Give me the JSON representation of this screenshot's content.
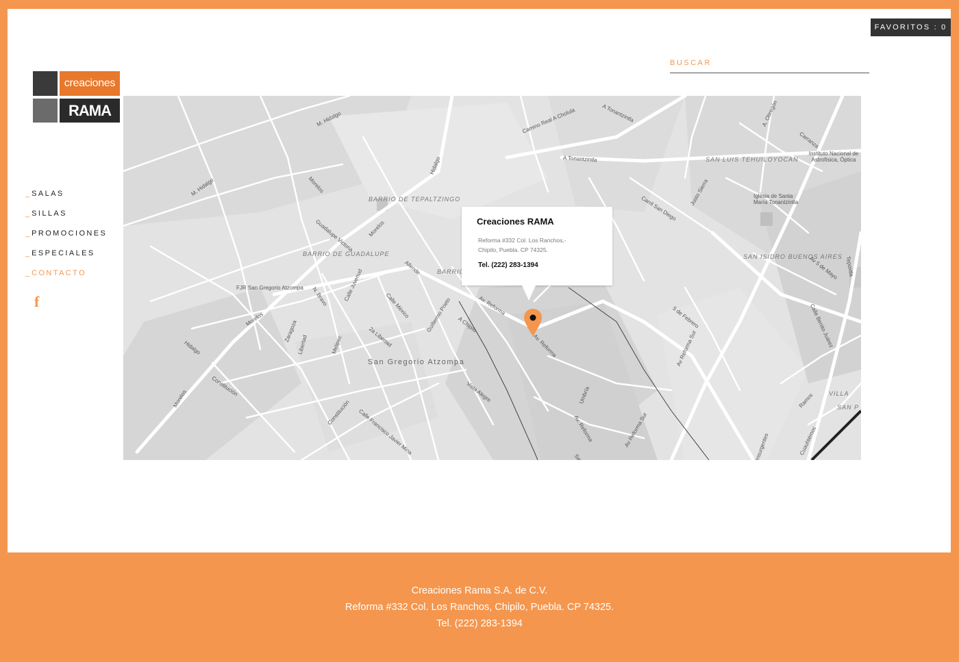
{
  "header": {
    "favorites_label": "FAVORITOS : 0",
    "search_label": "BUSCAR"
  },
  "logo": {
    "top_text": "creaciones",
    "bottom_text": "RAMA"
  },
  "nav": {
    "items": [
      {
        "label": "SALAS",
        "dash": "_"
      },
      {
        "label": "SILLAS",
        "dash": "_"
      },
      {
        "label": "PROMOCIONES",
        "dash": "_"
      },
      {
        "label": "ESPECIALES",
        "dash": "_"
      },
      {
        "label": "CONTACTO",
        "dash": "_"
      }
    ],
    "social_icon": "facebook-icon",
    "social_glyph": "f"
  },
  "map": {
    "labels": {
      "m_hidalgo": "M. Hidalgo",
      "m_hidalgo2": "M. Hidalgo",
      "hidalgo": "Hidalgo",
      "hidalgo2": "Hidalgo",
      "morelos": "Morelos",
      "morelos2": "Morelos",
      "morelos3": "Morelos",
      "morelos4": "Morelos",
      "camino_real": "Camino Real A Cholula",
      "a_tonantzintla": "A Tonantzintla",
      "a_tonantzintla2": "A Tonantzintla",
      "barrio_tepaltzingo": "BARRIO DE TEPALTZINGO",
      "guadalupe_victoria": "Guadalupe Victoria",
      "barrio_guadalupe": "BARRIO DE GUADALUPE",
      "barrio_tzocu": "BARRIO TZOCU",
      "allende": "Allende",
      "fjr": "FJR San Gregorio Atzompa",
      "n_bravo": "N. Bravo",
      "calle_juvenud": "Calle Juvenud",
      "calle_mexico": "Calle México",
      "zaragoza": "Zaragoza",
      "libertad": "Libertad",
      "melipec": "Melipec",
      "la_libertad": "2a Libertad",
      "guillermo_prieto": "Guillermo Prieto",
      "a_chipilo": "A Chipilo",
      "av_reforma": "Av. Reforma",
      "av_reforma2": "Av. Reforma",
      "av_reforma3": "Av. Reforma",
      "san_gregorio": "San Gregorio Atzompa",
      "constitucion": "Constitución",
      "constitucion2": "Constitución",
      "calle_fjm": "Calle Francisco Javier Mina",
      "vista_alegre": "Vista Alegre",
      "umbria": "Umbría",
      "av_reforma_sur": "Av Reforma Sur",
      "av_reforma_sur2": "Av Reforma Sur",
      "cerro_san_diego": "Carril San Diego",
      "justo_sierra": "Justo Sierra",
      "san_luis": "SAN LUIS TEHUILOYOCAN",
      "iglesia": "Iglesia de Santa María Tonantzintla",
      "san_isidro": "SAN ISIDRO BUENOS AIRES",
      "cinco_febrero": "5 de Febrero",
      "av_5_mayo": "Av 5 de Mayo",
      "calle_benito": "Calle Benito Juárez",
      "tepoxtla": "Tepoxtla",
      "a_obregon": "A. Obregón",
      "carranza": "Carranza",
      "instituto": "Instituto Nacional de Astrofísica, Óptica",
      "villa": "VILLA",
      "san_p": "SAN P",
      "ramos": "Ramos",
      "cuauhtemoc": "Cuauhtémoc",
      "insurgentes": "Insurgentes",
      "san": "San"
    }
  },
  "popup": {
    "title": "Creaciones RAMA",
    "address_line1": "Reforma #332 Col. Los Ranchos,-",
    "address_line2": "Chipilo, Puebla. CP 74325.",
    "phone": "Tel. (222) 283-1394"
  },
  "footer": {
    "company": "Creaciones Rama S.A. de C.V.",
    "address": "Reforma #332 Col. Los Ranchos, Chipilo, Puebla. CP 74325.",
    "phone": "Tel. (222) 283-1394"
  },
  "colors": {
    "accent": "#f4964e",
    "dark": "#333333"
  }
}
